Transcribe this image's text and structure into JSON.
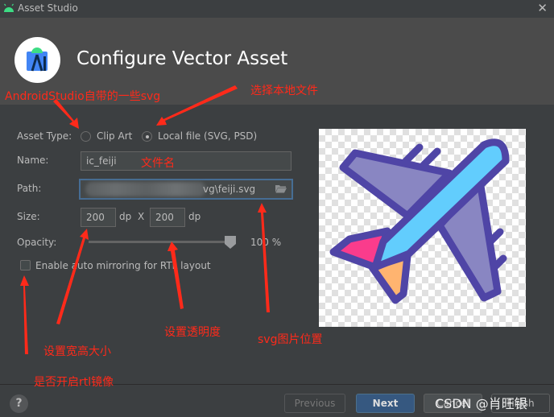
{
  "window": {
    "title": "Asset Studio",
    "close_label": "✕"
  },
  "header": {
    "heading": "Configure Vector Asset"
  },
  "form": {
    "asset_type_label": "Asset Type:",
    "asset_type_options": [
      {
        "label": "Clip Art",
        "selected": false
      },
      {
        "label": "Local file (SVG, PSD)",
        "selected": true
      }
    ],
    "name_label": "Name:",
    "name_value": "ic_feiji",
    "path_label": "Path:",
    "path_value": "vg\\feiji.svg",
    "size_label": "Size:",
    "width_value": "200",
    "height_value": "200",
    "unit": "dp",
    "times": "X",
    "opacity_label": "Opacity:",
    "opacity_value": "100 %",
    "opacity_fraction": 1.0,
    "mirroring_label": "Enable auto mirroring for RTL layout",
    "mirroring_checked": false
  },
  "footer": {
    "help_label": "?",
    "previous_label": "Previous",
    "next_label": "Next",
    "cancel_label": "Cancel",
    "finish_label": "Finish"
  },
  "annotations": {
    "clip_art": "AndroidStudio自带的一些svg",
    "local_file": "选择本地文件",
    "file_name": "文件名",
    "size": "设置宽高大小",
    "opacity": "设置透明度",
    "svg_location": "svg图片位置",
    "rtl": "是否开启rtl镜像"
  },
  "watermark": "CSDN @肖旺银",
  "colors": {
    "accent": "#365880",
    "annotation": "#ff2a1a",
    "plane_outline": "#4f45a6",
    "plane_body": "#62cdfd",
    "plane_wing": "#8986c2",
    "plane_tail_pink": "#fa3c8c",
    "plane_tail_orange": "#ffb470"
  }
}
